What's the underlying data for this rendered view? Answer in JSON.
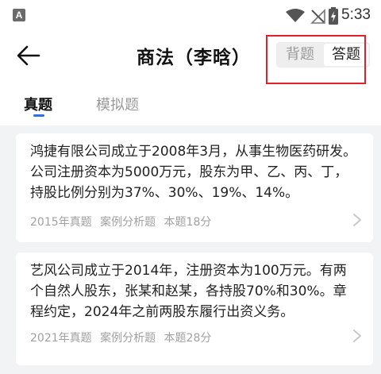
{
  "status_bar": {
    "app_icon_letter": "A",
    "time": "5:33",
    "icons": [
      "wifi-icon",
      "no-signal-icon",
      "battery-charging-icon"
    ]
  },
  "header": {
    "back_icon": "arrow-left-icon",
    "title": "商法（李晗）",
    "mode_toggle": {
      "options": [
        "背题",
        "答题"
      ],
      "selected": "答题"
    }
  },
  "tabs": [
    {
      "label": "真题",
      "active": true
    },
    {
      "label": "模拟题",
      "active": false
    }
  ],
  "questions": [
    {
      "text": "鸿捷有限公司成立于2008年3月，从事生物医药研发。公司注册资本为5000万元，股东为甲、乙、丙、丁，持股比例分别为37%、30%、19%、14%。",
      "year_tag": "2015年真题",
      "type_tag": "案例分析题",
      "score_tag": "本题18分"
    },
    {
      "text": "艺风公司成立于2014年，注册资本为100万元。有两个自然人股东，张某和赵某，各持股70%和30%。章程约定，2024年之前两股东履行出资义务。",
      "year_tag": "2021年真题",
      "type_tag": "案例分析题",
      "score_tag": "本题28分"
    }
  ],
  "colors": {
    "accent": "#2f6fed",
    "highlight": "#e0202a",
    "background": "#f2f3f5"
  }
}
